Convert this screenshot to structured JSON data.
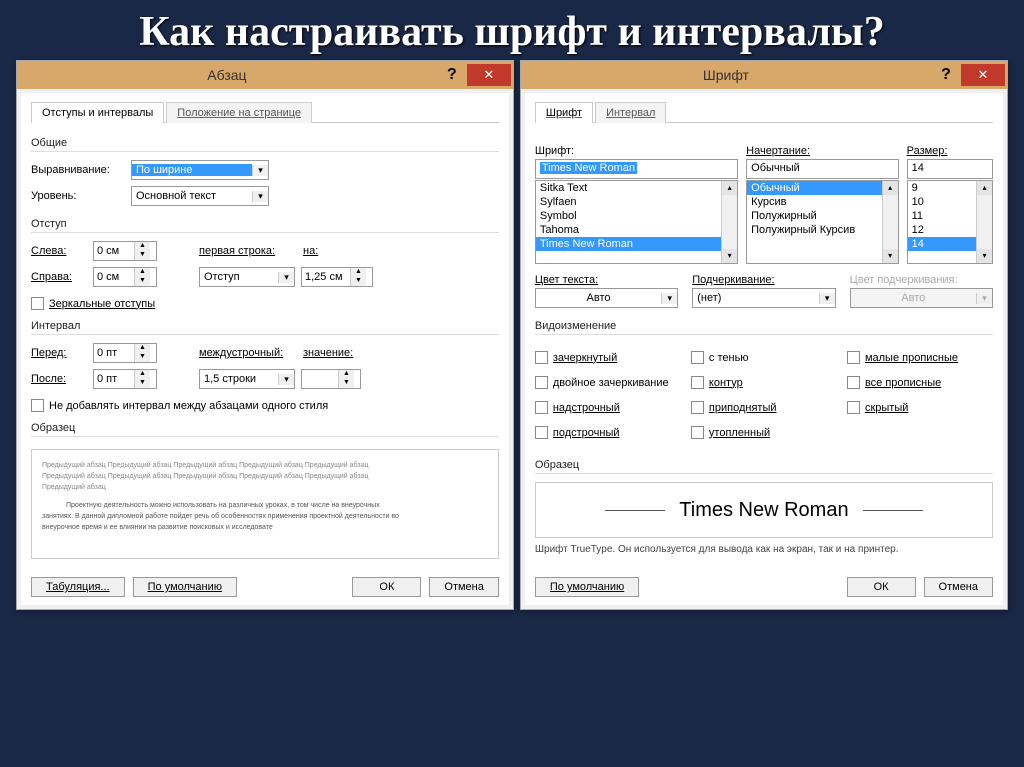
{
  "slide": {
    "title": "Как настраивать шрифт и интервалы?"
  },
  "para": {
    "title": "Абзац",
    "tabs": {
      "active": "Отступы и интервалы",
      "inactive": "Положение на странице"
    },
    "groups": {
      "general": "Общие",
      "indent": "Отступ",
      "spacing": "Интервал",
      "sample": "Образец"
    },
    "general": {
      "align_label": "Выравнивание:",
      "align_value": "По ширине",
      "level_label": "Уровень:",
      "level_value": "Основной текст"
    },
    "indent": {
      "left_label": "Слева:",
      "left_value": "0 см",
      "right_label": "Справа:",
      "right_value": "0 см",
      "first_label": "первая строка:",
      "first_value": "Отступ",
      "by_label": "на:",
      "by_value": "1,25 см",
      "mirror": "Зеркальные отступы"
    },
    "spacing": {
      "before_label": "Перед:",
      "before_value": "0 пт",
      "after_label": "После:",
      "after_value": "0 пт",
      "line_label": "междустрочный:",
      "line_value": "1,5 строки",
      "at_label": "значение:",
      "at_value": "",
      "nospace": "Не добавлять интервал между абзацами одного стиля"
    },
    "preview": {
      "l1": "Предыдущий абзац Предыдущий абзац Предыдущий абзац Предыдущий абзац Предыдущий абзац",
      "l2": "Предыдущий абзац Предыдущий абзац Предыдущий абзац Предыдущий абзац Предыдущий абзац",
      "l3": "Предыдущий абзац",
      "l4": "Проектную деятельность можно использовать на различных уроках, в том числе на внеурочных",
      "l5": "занятиях. В данной дипломной работе пойдет речь об особенностях применения проектной деятельности во",
      "l6": "внеурочное время и ее влиянии на развитие поисковых и исследовате"
    },
    "buttons": {
      "tabs": "Табуляция...",
      "default": "По умолчанию",
      "ok": "ОК",
      "cancel": "Отмена"
    }
  },
  "font": {
    "title": "Шрифт",
    "tabs": {
      "active": "Шрифт",
      "inactive": "Интервал"
    },
    "font_label": "Шрифт:",
    "font_value": "Times New Roman",
    "font_list": [
      "Sitka Text",
      "Sylfaen",
      "Symbol",
      "Tahoma",
      "Times New Roman"
    ],
    "style_label": "Начертание:",
    "style_value": "Обычный",
    "style_list": [
      "Обычный",
      "Курсив",
      "Полужирный",
      "Полужирный Курсив"
    ],
    "size_label": "Размер:",
    "size_value": "14",
    "size_list": [
      "9",
      "10",
      "11",
      "12",
      "14"
    ],
    "color_label": "Цвет текста:",
    "color_value": "Авто",
    "underline_label": "Подчеркивание:",
    "underline_value": "(нет)",
    "ucolor_label": "Цвет подчеркивания:",
    "ucolor_value": "Авто",
    "effects_label": "Видоизменение",
    "effects": {
      "c1": [
        "зачеркнутый",
        "двойное зачеркивание",
        "надстрочный",
        "подстрочный"
      ],
      "c2": [
        "с тенью",
        "контур",
        "приподнятый",
        "утопленный"
      ],
      "c3": [
        "малые прописные",
        "все прописные",
        "скрытый"
      ]
    },
    "sample_label": "Образец",
    "sample_text": "Times New Roman",
    "hint": "Шрифт TrueType. Он используется для вывода как на экран, так и на принтер.",
    "buttons": {
      "default": "По умолчанию",
      "ok": "ОК",
      "cancel": "Отмена"
    }
  },
  "common": {
    "help": "?",
    "close": "✕"
  }
}
